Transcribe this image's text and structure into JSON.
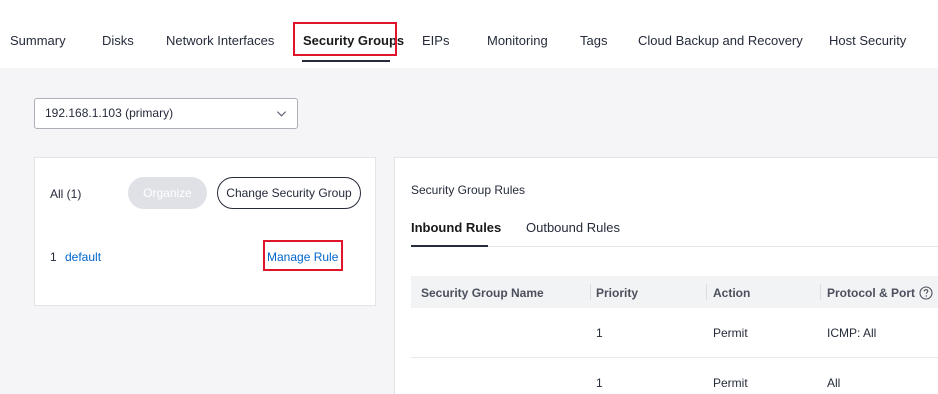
{
  "tabs": [
    {
      "label": "Summary",
      "active": false
    },
    {
      "label": "Disks",
      "active": false
    },
    {
      "label": "Network Interfaces",
      "active": false
    },
    {
      "label": "Security Groups",
      "active": true
    },
    {
      "label": "EIPs",
      "active": false
    },
    {
      "label": "Monitoring",
      "active": false
    },
    {
      "label": "Tags",
      "active": false
    },
    {
      "label": "Cloud Backup and Recovery",
      "active": false
    },
    {
      "label": "Host Security",
      "active": false
    }
  ],
  "nic_select": {
    "value": "192.168.1.103 (primary)",
    "icon": "chevron-down-icon"
  },
  "left_panel": {
    "all_label": "All (1)",
    "organize_label": "Organize",
    "change_label": "Change Security Group",
    "groups": [
      {
        "index": "1",
        "name": "default",
        "manage_label": "Manage Rule"
      }
    ]
  },
  "rules_panel": {
    "title": "Security Group Rules",
    "tabs": [
      {
        "label": "Inbound Rules",
        "active": true
      },
      {
        "label": "Outbound Rules",
        "active": false
      }
    ],
    "columns": [
      "Security Group Name",
      "Priority",
      "Action",
      "Protocol & Port"
    ],
    "rows": [
      {
        "group": "",
        "priority": "1",
        "action": "Permit",
        "protocol": "ICMP: All"
      },
      {
        "group": "",
        "priority": "1",
        "action": "Permit",
        "protocol": "All"
      }
    ]
  },
  "colors": {
    "highlight": "#e0142b",
    "link": "#0066cc",
    "text": "#252b3a",
    "background": "#f5f5f7"
  }
}
